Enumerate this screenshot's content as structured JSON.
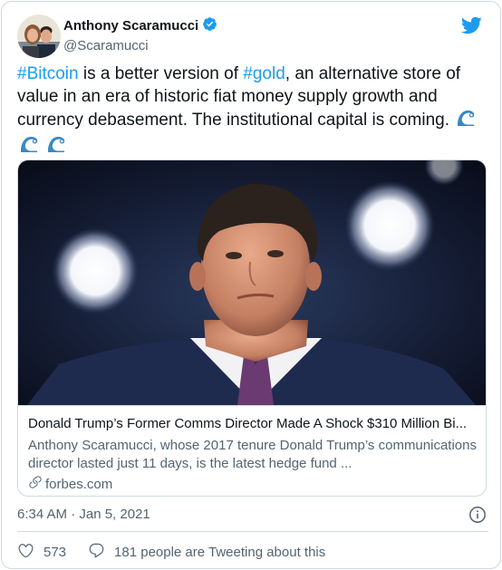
{
  "author": {
    "display_name": "Anthony Scaramucci",
    "handle": "@Scaramucci",
    "verified": true
  },
  "tweet": {
    "segments": [
      {
        "text": "#Bitcoin",
        "hashtag": true
      },
      {
        "text": " is a better version of ",
        "hashtag": false
      },
      {
        "text": "#gold",
        "hashtag": true
      },
      {
        "text": ", an alternative store of value in an era of historic fiat money supply growth and currency debasement. The institutional capital is coming. ",
        "hashtag": false
      }
    ],
    "emoji": [
      "wave-emoji",
      "wave-emoji",
      "wave-emoji"
    ]
  },
  "link_card": {
    "title": "Donald Trump’s Former Comms Director Made A Shock $310 Million Bi...",
    "description": "Anthony Scaramucci, whose 2017 tenure Donald Trump’s communications director lasted just 11 days, is the latest hedge fund ...",
    "domain": "forbes.com"
  },
  "meta": {
    "timestamp": "6:34 AM · Jan 5, 2021"
  },
  "actions": {
    "likes": "573",
    "replies_label": "181 people are Tweeting about this"
  },
  "colors": {
    "accent": "#1d9bf0",
    "text": "#0f1419",
    "secondary": "#536471",
    "border": "#cfd9de"
  }
}
